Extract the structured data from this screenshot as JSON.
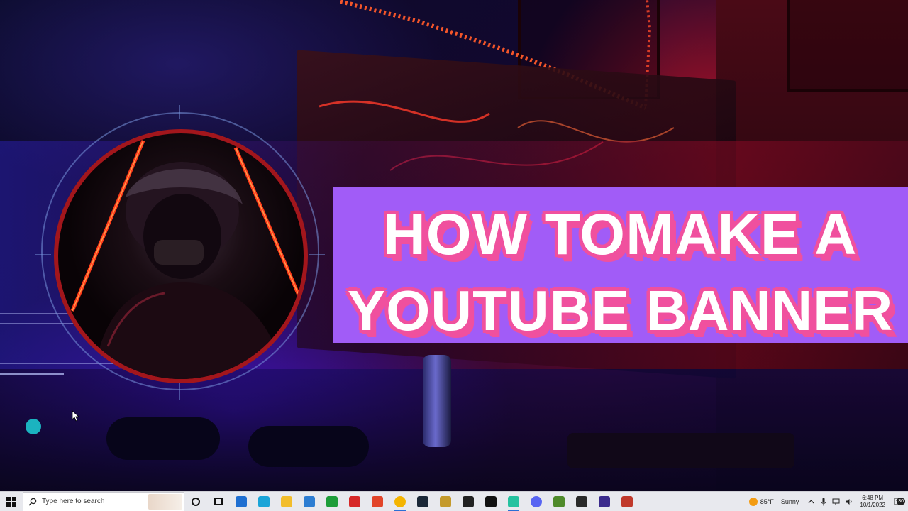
{
  "title_card": {
    "line1": "HOW TOMAKE A",
    "line2": "YOUTUBE BANNER"
  },
  "colors": {
    "title_bg": "#a15cf7",
    "title_outline": "#f0509e",
    "accent_dot": "#1bb3c0",
    "avatar_border": "#a2161c",
    "taskbar_bg": "#e8e9ee"
  },
  "taskbar": {
    "search_placeholder": "Type here to search",
    "apps": [
      {
        "name": "cortana-icon",
        "color": "#111111"
      },
      {
        "name": "task-view-icon",
        "color": "#111111"
      },
      {
        "name": "mail-icon",
        "color": "#1f6fd1"
      },
      {
        "name": "edge-icon",
        "color": "#1aa4d8"
      },
      {
        "name": "file-explorer-icon",
        "color": "#f2bd2c"
      },
      {
        "name": "store-icon",
        "color": "#2d7dd2"
      },
      {
        "name": "xbox-icon",
        "color": "#1e9d3a"
      },
      {
        "name": "red-app-icon",
        "color": "#d62828"
      },
      {
        "name": "office-icon",
        "color": "#e2452a"
      },
      {
        "name": "chrome-icon",
        "color": "#f4b400"
      },
      {
        "name": "steam-icon",
        "color": "#1b2838"
      },
      {
        "name": "game-app-icon",
        "color": "#c49a2c"
      },
      {
        "name": "roblox-icon",
        "color": "#222222"
      },
      {
        "name": "tiktok-icon",
        "color": "#111111"
      },
      {
        "name": "green-app-icon",
        "color": "#25c2a0"
      },
      {
        "name": "discord-icon",
        "color": "#5865f2"
      },
      {
        "name": "minecraft-icon",
        "color": "#4f8a2b"
      },
      {
        "name": "epic-games-icon",
        "color": "#2a2a2a"
      },
      {
        "name": "amazon-games-icon",
        "color": "#3b2b8c"
      },
      {
        "name": "video-app-icon",
        "color": "#c0392b"
      }
    ],
    "weather": {
      "temp": "85°F",
      "condition": "Sunny"
    },
    "clock": {
      "time": "6:48 PM",
      "date": "10/1/2022"
    },
    "notifications_count": "30"
  }
}
